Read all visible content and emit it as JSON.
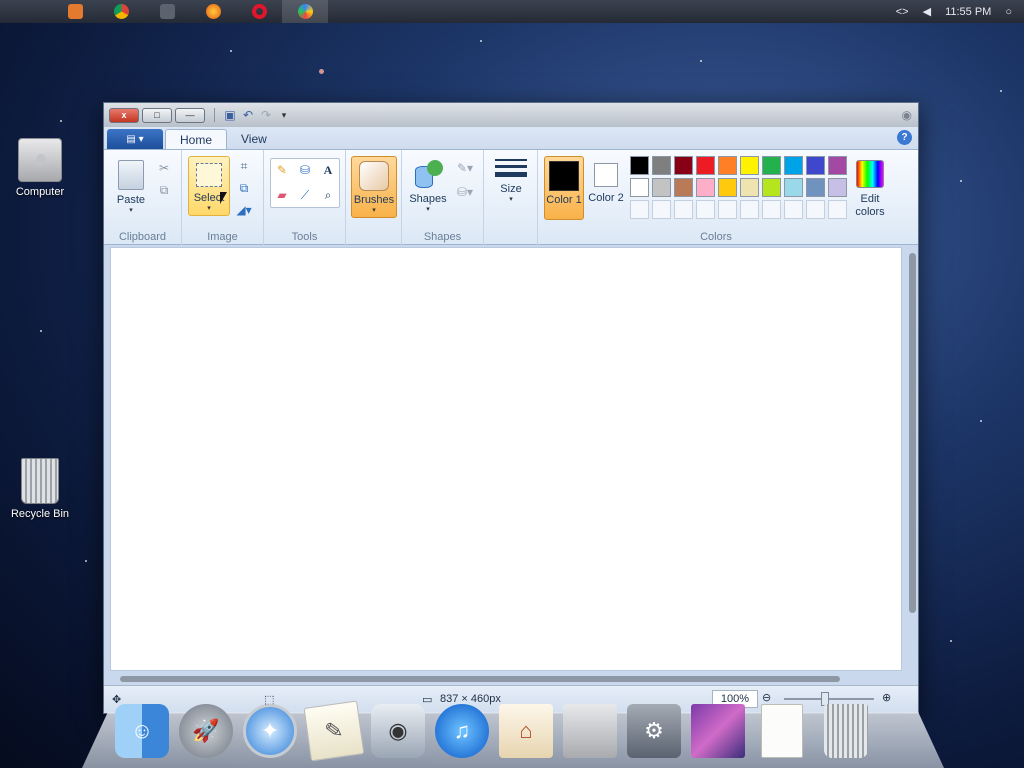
{
  "menubar": {
    "apple_icon": "apple-icon",
    "apps": [
      "media-player-icon",
      "chrome-icon",
      "blank-app-icon",
      "firefox-icon",
      "opera-icon",
      "paint-icon"
    ],
    "right": {
      "code_icon": "<>",
      "volume_icon": "volume-icon",
      "clock": "11:55 PM",
      "search_icon": "search-icon"
    }
  },
  "desktop": {
    "icons": [
      {
        "label": "Computer"
      },
      {
        "label": "Recycle Bin"
      }
    ]
  },
  "window": {
    "titlebar": {
      "close": "x",
      "maximize": "□",
      "minimize": "—",
      "quick_access": [
        "save-icon",
        "undo-icon",
        "redo-icon",
        "customize-icon"
      ]
    },
    "tabs": [
      {
        "label": "Home",
        "active": true
      },
      {
        "label": "View",
        "active": false
      }
    ],
    "help": "?",
    "ribbon": {
      "clipboard": {
        "paste": "Paste",
        "group": "Clipboard"
      },
      "image": {
        "select": "Select",
        "group": "Image"
      },
      "tools": {
        "group": "Tools"
      },
      "brushes": {
        "label": "Brushes"
      },
      "shapes": {
        "label": "Shapes",
        "group": "Shapes"
      },
      "size": {
        "label": "Size"
      },
      "colors": {
        "color1": "Color 1",
        "color2": "Color 2",
        "edit": "Edit colors",
        "group": "Colors",
        "color1_value": "#000000",
        "color2_value": "#ffffff",
        "palette_row1": [
          "#000000",
          "#7f7f7f",
          "#880015",
          "#ed1c24",
          "#ff7f27",
          "#fff200",
          "#22b14c",
          "#00a2e8",
          "#3f48cc",
          "#a349a4"
        ],
        "palette_row2": [
          "#ffffff",
          "#c3c3c3",
          "#b97a57",
          "#ffaec9",
          "#ffc90e",
          "#efe4b0",
          "#b5e61d",
          "#99d9ea",
          "#7092be",
          "#c8bfe7"
        ]
      }
    },
    "status": {
      "move_icon": "move-icon",
      "selection_icon": "selection-icon",
      "canvas_icon": "canvas-size-icon",
      "canvas_size": "837 × 460px",
      "zoom": "100%"
    }
  },
  "dock": {
    "items": [
      "finder-icon",
      "launchpad-icon",
      "safari-icon",
      "textedit-icon",
      "photo-booth-icon",
      "itunes-icon",
      "home-icon",
      "mac-pro-icon",
      "system-preferences-icon",
      "wallpaper-icon",
      "document-icon",
      "trash-icon"
    ]
  }
}
